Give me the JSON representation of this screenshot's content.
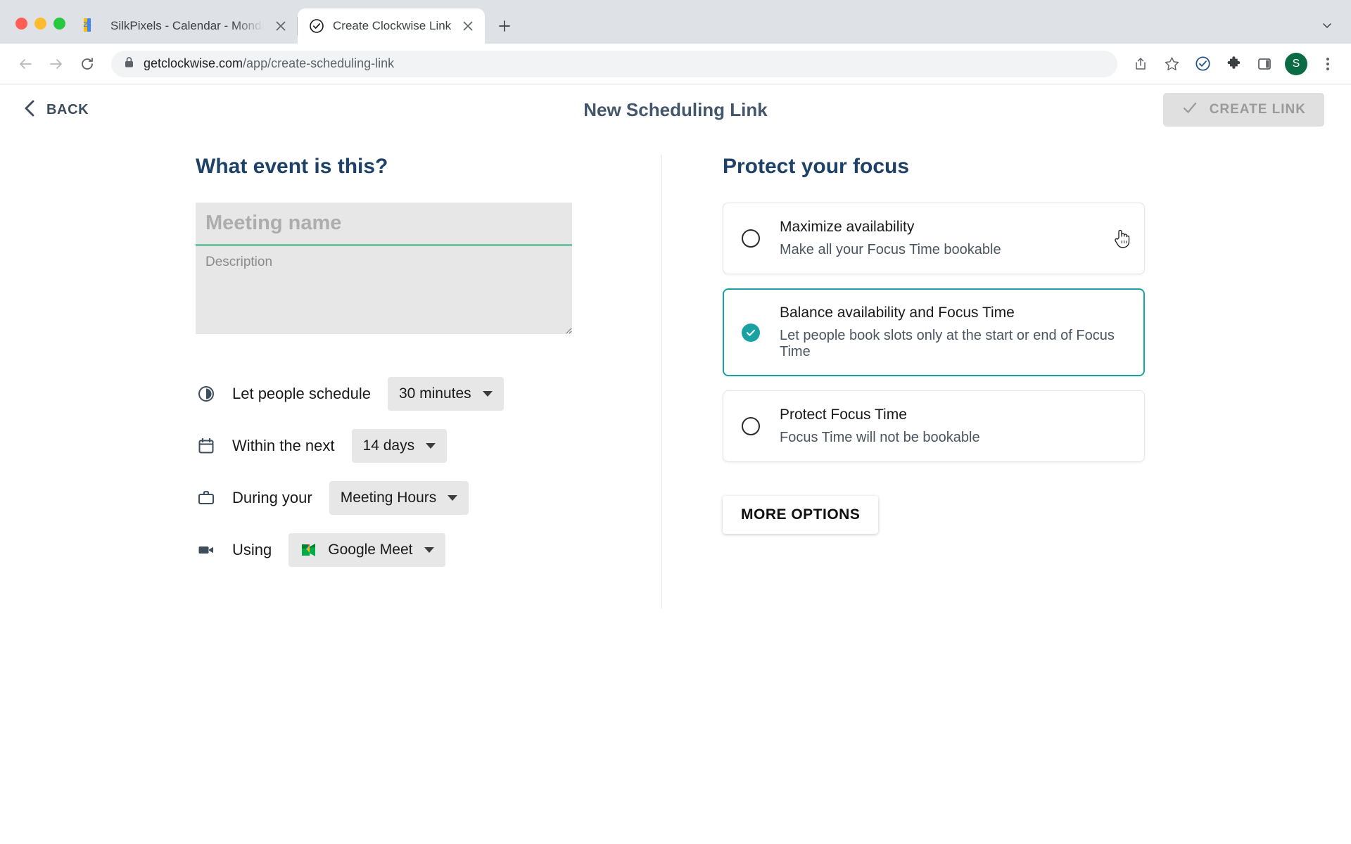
{
  "browser": {
    "tabs": [
      {
        "title": "SilkPixels - Calendar - Monday",
        "favicon": "google-calendar-icon",
        "favicon_day": "28",
        "active": false
      },
      {
        "title": "Create Clockwise Link",
        "favicon": "clockwise-check-icon",
        "active": true
      }
    ],
    "new_tab_label": "+",
    "tab_list_chevron": "chevron-down-icon",
    "toolbar": {
      "back": "back-arrow-icon",
      "forward": "forward-arrow-icon",
      "reload": "reload-icon",
      "lock": "lock-icon",
      "url_domain": "getclockwise.com",
      "url_path": "/app/create-scheduling-link",
      "share": "share-icon",
      "bookmark": "star-icon",
      "extension_clockwise": "clockwise-check-icon",
      "extensions": "puzzle-icon",
      "side_panel": "side-panel-icon",
      "avatar_initial": "S",
      "menu": "three-dot-menu-icon"
    }
  },
  "app": {
    "header": {
      "back_label": "BACK",
      "back_icon": "chevron-left-icon",
      "title": "New Scheduling Link",
      "create_label": "CREATE LINK",
      "create_icon": "check-icon"
    },
    "event_section": {
      "title": "What event is this?",
      "name_placeholder": "Meeting name",
      "name_value": "",
      "description_placeholder": "Description",
      "description_value": "",
      "rows": [
        {
          "icon": "clock-icon",
          "label": "Let people schedule",
          "value": "30 minutes",
          "has_logo": false
        },
        {
          "icon": "calendar-icon",
          "label": "Within the next",
          "value": "14 days",
          "has_logo": false
        },
        {
          "icon": "briefcase-icon",
          "label": "During your",
          "value": "Meeting Hours",
          "has_logo": false
        },
        {
          "icon": "video-icon",
          "label": "Using",
          "value": "Google Meet",
          "has_logo": true,
          "logo": "google-meet-icon"
        }
      ]
    },
    "focus_section": {
      "title": "Protect your focus",
      "options": [
        {
          "title": "Maximize availability",
          "subtitle": "Make all your Focus Time bookable",
          "selected": false,
          "cursor": true
        },
        {
          "title": "Balance availability and Focus Time",
          "subtitle": "Let people book slots only at the start or end of Focus Time",
          "selected": true,
          "cursor": false
        },
        {
          "title": "Protect Focus Time",
          "subtitle": "Focus Time will not be bookable",
          "selected": false,
          "cursor": false
        }
      ],
      "more_options_label": "MORE OPTIONS"
    }
  },
  "colors": {
    "accent_teal": "#1aa1a1",
    "heading_navy": "#1e4168",
    "header_slate": "#44566b",
    "input_green_underline": "#6fc3a0",
    "avatar_green": "#0b6b45"
  }
}
